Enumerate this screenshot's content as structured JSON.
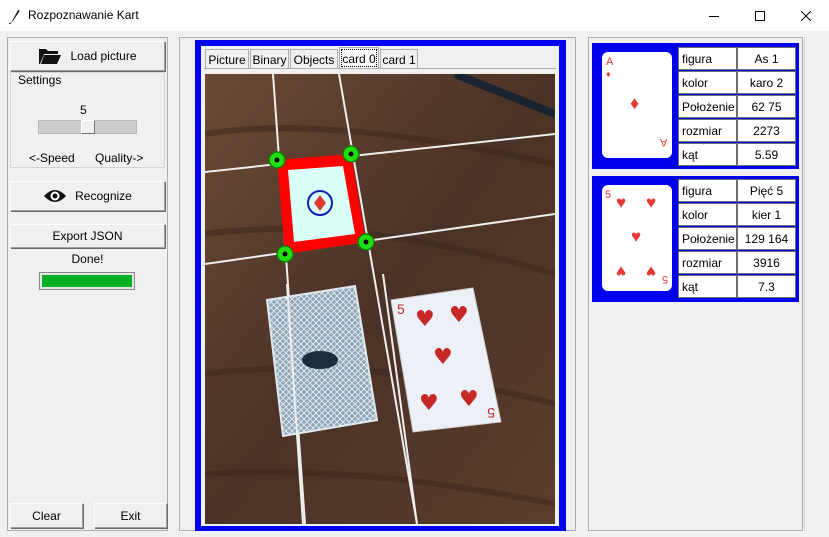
{
  "window": {
    "title": "Rozpoznawanie Kart"
  },
  "controls": {
    "load_label": "Load picture",
    "settings_label": "Settings",
    "slider_value": "5",
    "slider_level": 0.5,
    "speed_label": "<-Speed",
    "quality_label": "Quality->",
    "recognize_label": "Recognize",
    "export_label": "Export JSON",
    "status": "Done!",
    "progress": 1.0,
    "clear_label": "Clear",
    "exit_label": "Exit"
  },
  "tabs": [
    "Picture",
    "Binary",
    "Objects",
    "card 0",
    "card 1"
  ],
  "active_tab": "card 0",
  "cards": [
    {
      "rank_symbol": "A",
      "rows": [
        {
          "label": "figura",
          "value": "As 1"
        },
        {
          "label": "kolor",
          "value": "karo 2"
        },
        {
          "label": "Położenie",
          "value": "62 75"
        },
        {
          "label": "rozmiar",
          "value": "2273"
        },
        {
          "label": "kąt",
          "value": "5.59"
        }
      ]
    },
    {
      "rank_symbol": "5",
      "rows": [
        {
          "label": "figura",
          "value": "Pięć 5"
        },
        {
          "label": "kolor",
          "value": "kier 1"
        },
        {
          "label": "Położenie",
          "value": "129 164"
        },
        {
          "label": "rozmiar",
          "value": "3916"
        },
        {
          "label": "kąt",
          "value": "7.3"
        }
      ]
    }
  ],
  "colors": {
    "accent": "#0000ee",
    "detect": "#ff0000",
    "marker": "#22dd11",
    "progress": "#06b025",
    "red_suit": "#e53935"
  },
  "icons": {
    "app": "feather-icon",
    "load": "folder-open-icon",
    "recognize": "eye-icon"
  }
}
